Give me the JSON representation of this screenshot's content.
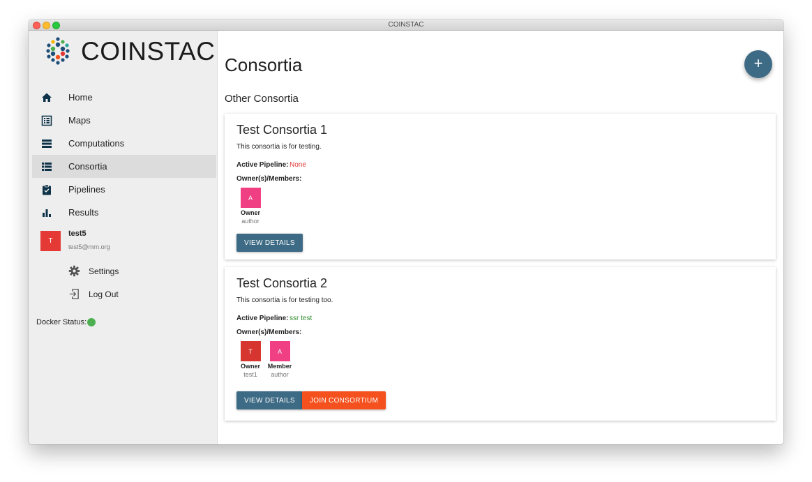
{
  "window": {
    "title": "COINSTAC"
  },
  "sidebar": {
    "brand": "COINSTAC",
    "items": [
      {
        "label": "Home",
        "icon": "home-icon"
      },
      {
        "label": "Maps",
        "icon": "maps-icon"
      },
      {
        "label": "Computations",
        "icon": "computations-icon"
      },
      {
        "label": "Consortia",
        "icon": "consortia-icon",
        "active": true
      },
      {
        "label": "Pipelines",
        "icon": "pipelines-icon"
      },
      {
        "label": "Results",
        "icon": "results-icon"
      }
    ],
    "user": {
      "initial": "T",
      "name": "test5",
      "email": "test5@mrn.org",
      "settings_label": "Settings",
      "logout_label": "Log Out"
    },
    "docker": {
      "label": "Docker Status:",
      "status_color": "#4caf50"
    }
  },
  "main": {
    "title": "Consortia",
    "fab_label": "+",
    "section_title": "Other Consortia",
    "consortia": [
      {
        "title": "Test Consortia 1",
        "description": "This consortia is for testing.",
        "active_pipeline_label": "Active Pipeline:",
        "active_pipeline_value": "None",
        "active_pipeline_color": "#e53935",
        "members_label": "Owner(s)/Members:",
        "members": [
          {
            "initial": "A",
            "role": "Owner",
            "name": "author",
            "color": "#f03f82"
          }
        ],
        "view_details_label": "VIEW DETAILS"
      },
      {
        "title": "Test Consortia 2",
        "description": "This consortia is for testing too.",
        "active_pipeline_label": "Active Pipeline:",
        "active_pipeline_value": "ssr test",
        "active_pipeline_color": "#2e8b2e",
        "members_label": "Owner(s)/Members:",
        "members": [
          {
            "initial": "T",
            "role": "Owner",
            "name": "test1",
            "color": "#d6362f"
          },
          {
            "initial": "A",
            "role": "Member",
            "name": "author",
            "color": "#f03f82"
          }
        ],
        "view_details_label": "VIEW DETAILS",
        "join_label": "JOIN CONSORTIUM"
      }
    ]
  },
  "colors": {
    "primary": "#3d6a84",
    "accent": "#f4511e"
  }
}
